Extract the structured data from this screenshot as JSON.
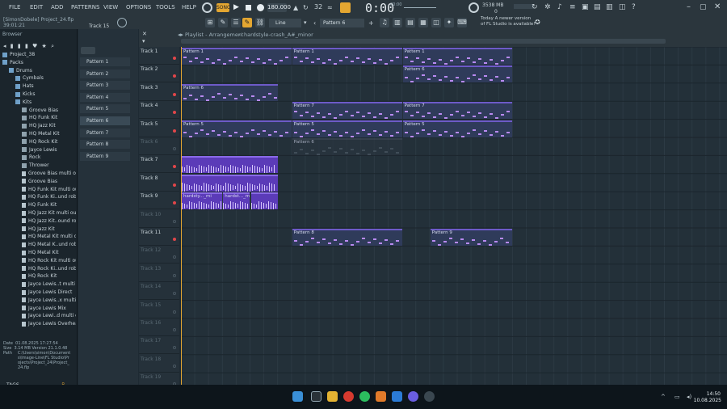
{
  "menu": [
    "FILE",
    "EDIT",
    "ADD",
    "PATTERNS",
    "VIEW",
    "OPTIONS",
    "TOOLS",
    "HELP"
  ],
  "transport": {
    "bpm": "180.000",
    "time": "0:00",
    "time_sub": "00:00",
    "pattern": "Pattern 6",
    "snap": "Line",
    "cpu": "3538 MB",
    "cpu2": "0"
  },
  "notice": "Today  A newer version of FL Studio is available!",
  "project": {
    "user": "[SimonDobele]",
    "file": "Project_24.flp",
    "time": "39:01:21"
  },
  "track_label": "Track 15",
  "browser": {
    "title": "Browser",
    "items": [
      {
        "label": "Project_38",
        "kind": "folder",
        "indent": 0
      },
      {
        "label": "Packs",
        "kind": "folder",
        "indent": 0
      },
      {
        "label": "Drums",
        "kind": "folder",
        "indent": 1
      },
      {
        "label": "Cymbals",
        "kind": "folder",
        "indent": 2
      },
      {
        "label": "Hats",
        "kind": "folder",
        "indent": 2
      },
      {
        "label": "Kicks",
        "kind": "folder",
        "indent": 2
      },
      {
        "label": "Kits",
        "kind": "folder",
        "indent": 2
      },
      {
        "label": "Groove Bias",
        "kind": "kit",
        "indent": 3
      },
      {
        "label": "HQ Funk Kit",
        "kind": "kit",
        "indent": 3
      },
      {
        "label": "HQ Jazz Kit",
        "kind": "kit",
        "indent": 3
      },
      {
        "label": "HQ Metal Kit",
        "kind": "kit",
        "indent": 3
      },
      {
        "label": "HQ Rock Kit",
        "kind": "kit",
        "indent": 3
      },
      {
        "label": "Jayce Lewis",
        "kind": "kit",
        "indent": 3
      },
      {
        "label": "Rock",
        "kind": "kit",
        "indent": 3
      },
      {
        "label": "Thrower",
        "kind": "kit",
        "indent": 3
      },
      {
        "label": "Groove Bias multi out",
        "kind": "sample",
        "indent": 3
      },
      {
        "label": "Groove Bias",
        "kind": "sample",
        "indent": 3
      },
      {
        "label": "HQ Funk Kit multi out",
        "kind": "sample",
        "indent": 3
      },
      {
        "label": "HQ Funk Ki..und robin",
        "kind": "sample",
        "indent": 3
      },
      {
        "label": "HQ Funk Kit",
        "kind": "sample",
        "indent": 3
      },
      {
        "label": "HQ Jazz Kit multi out",
        "kind": "sample",
        "indent": 3
      },
      {
        "label": "HQ Jazz Kit..ound robin",
        "kind": "sample",
        "indent": 3
      },
      {
        "label": "HQ Jazz Kit",
        "kind": "sample",
        "indent": 3
      },
      {
        "label": "HQ Metal Kit multi out",
        "kind": "sample",
        "indent": 3
      },
      {
        "label": "HQ Metal K..und robin",
        "kind": "sample",
        "indent": 3
      },
      {
        "label": "HQ Metal Kit",
        "kind": "sample",
        "indent": 3
      },
      {
        "label": "HQ Rock Kit multi out",
        "kind": "sample",
        "indent": 3
      },
      {
        "label": "HQ Rock Ki..und robin",
        "kind": "sample",
        "indent": 3
      },
      {
        "label": "HQ Rock Kit",
        "kind": "sample",
        "indent": 3
      },
      {
        "label": "Jayce Lewis..t multi out",
        "kind": "sample",
        "indent": 3
      },
      {
        "label": "Jayce Lewis Direct",
        "kind": "sample",
        "indent": 3
      },
      {
        "label": "Jayce Lewis..x multi out",
        "kind": "sample",
        "indent": 3
      },
      {
        "label": "Jayce Lewis Mix",
        "kind": "sample",
        "indent": 3
      },
      {
        "label": "Jayce Lewi..d multi out",
        "kind": "sample",
        "indent": 3
      },
      {
        "label": "Jayce Lewis Overhead",
        "kind": "sample",
        "indent": 3
      }
    ],
    "info": {
      "date_label": "Date",
      "date": "01.08.2025 17:27:54",
      "size_label": "Size",
      "size": "3.14 MB",
      "version": "Version 21.1.0.48",
      "path_label": "Path",
      "path": "C:\\Users\\simon\\Documents\\Image-Line\\FL Studio\\Projects\\Project_24\\Project_24.flp"
    },
    "tags": "TAGS"
  },
  "patterns": [
    "Pattern 1",
    "Pattern 2",
    "Pattern 3",
    "Pattern 4",
    "Pattern 5",
    "Pattern 6",
    "Pattern 7",
    "Pattern 8",
    "Pattern 9"
  ],
  "playlist": {
    "title": "Playlist - Arrangement",
    "crumb": "hardstyle-crash_A#_minor",
    "ruler": [
      "2",
      "3",
      "4",
      "5",
      "6",
      "7",
      "8",
      "9",
      "10",
      "11",
      "12",
      "13",
      "14",
      "15",
      "16",
      "17",
      "18",
      "19",
      "20",
      "21",
      "22",
      "23",
      "24",
      "25",
      "26",
      "27",
      "28",
      "29",
      "30",
      "31",
      "32",
      "33",
      "34",
      "35",
      "36",
      "37",
      "38"
    ],
    "tracks": [
      {
        "name": "Track 1",
        "active": true
      },
      {
        "name": "Track 2",
        "active": true
      },
      {
        "name": "Track 3",
        "active": true
      },
      {
        "name": "Track 4",
        "active": true
      },
      {
        "name": "Track 5",
        "active": true
      },
      {
        "name": "Track 6",
        "active": false
      },
      {
        "name": "Track 7",
        "active": true
      },
      {
        "name": "Track 8",
        "active": true
      },
      {
        "name": "Track 9",
        "active": true
      },
      {
        "name": "Track 10",
        "active": false
      },
      {
        "name": "Track 11",
        "active": true
      },
      {
        "name": "Track 12",
        "active": false
      },
      {
        "name": "Track 13",
        "active": false
      },
      {
        "name": "Track 14",
        "active": false
      },
      {
        "name": "Track 15",
        "active": false
      },
      {
        "name": "Track 16",
        "active": false
      },
      {
        "name": "Track 17",
        "active": false
      },
      {
        "name": "Track 18",
        "active": false
      },
      {
        "name": "Track 19",
        "active": false
      }
    ],
    "clips": [
      {
        "track": 0,
        "start": 0,
        "len": 8,
        "label": "Pattern 1",
        "kind": "pattern"
      },
      {
        "track": 0,
        "start": 8,
        "len": 8,
        "label": "Pattern 1",
        "kind": "pattern"
      },
      {
        "track": 0,
        "start": 16,
        "len": 8,
        "label": "Pattern 1",
        "kind": "pattern"
      },
      {
        "track": 1,
        "start": 16,
        "len": 8,
        "label": "Pattern 6",
        "kind": "pattern"
      },
      {
        "track": 2,
        "start": 0,
        "len": 7,
        "label": "Pattern 6",
        "kind": "pattern"
      },
      {
        "track": 3,
        "start": 8,
        "len": 8,
        "label": "Pattern 7",
        "kind": "pattern"
      },
      {
        "track": 3,
        "start": 16,
        "len": 8,
        "label": "Pattern 7",
        "kind": "pattern"
      },
      {
        "track": 4,
        "start": 0,
        "len": 8,
        "label": "Pattern 5",
        "kind": "pattern"
      },
      {
        "track": 4,
        "start": 8,
        "len": 8,
        "label": "Pattern 5",
        "kind": "pattern"
      },
      {
        "track": 4,
        "start": 16,
        "len": 8,
        "label": "Pattern 5",
        "kind": "pattern"
      },
      {
        "track": 5,
        "start": 8,
        "len": 8,
        "label": "Pattern 6",
        "kind": "ghost"
      },
      {
        "track": 6,
        "start": 0,
        "len": 7,
        "label": "",
        "kind": "audio"
      },
      {
        "track": 7,
        "start": 0,
        "len": 7,
        "label": "",
        "kind": "audio"
      },
      {
        "track": 8,
        "start": 0,
        "len": 3,
        "label": "hardsty..._mi",
        "kind": "audio"
      },
      {
        "track": 8,
        "start": 3,
        "len": 2,
        "label": "hardst..._mi",
        "kind": "audio"
      },
      {
        "track": 8,
        "start": 5,
        "len": 2,
        "label": "",
        "kind": "audio"
      },
      {
        "track": 10,
        "start": 8,
        "len": 8,
        "label": "Pattern 8",
        "kind": "pattern"
      },
      {
        "track": 10,
        "start": 18,
        "len": 6,
        "label": "Pattern 9",
        "kind": "pattern"
      }
    ]
  },
  "taskbar": {
    "time": "14:50",
    "date": "10.08.2025"
  }
}
